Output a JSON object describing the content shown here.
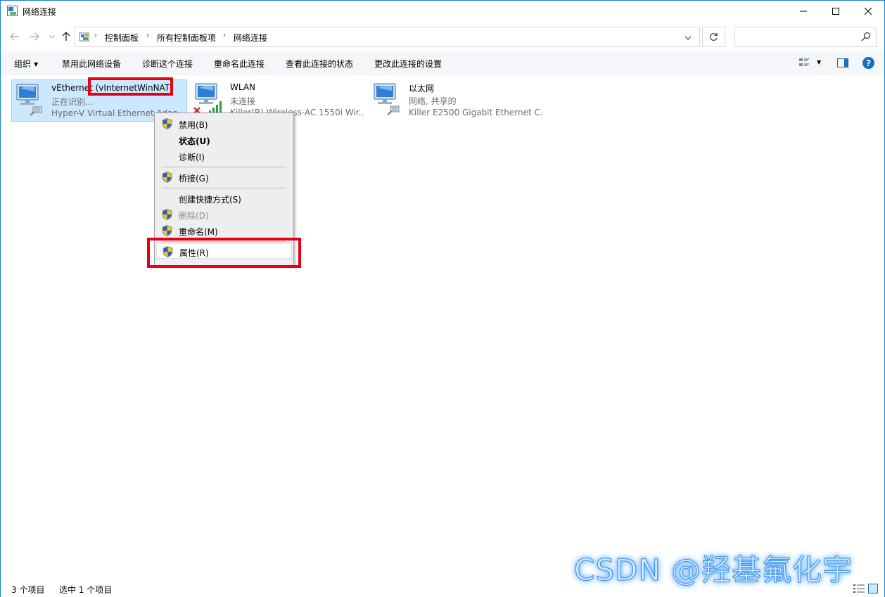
{
  "window": {
    "title": "网络连接",
    "controls": {
      "minimize": "—",
      "maximize": "☐",
      "close": "✕"
    }
  },
  "address": {
    "breadcrumbs": [
      "控制面板",
      "所有控制面板项",
      "网络连接"
    ],
    "search_placeholder": ""
  },
  "toolbar": {
    "organize": "组织",
    "commands": [
      "禁用此网络设备",
      "诊断这个连接",
      "重命名此连接",
      "查看此连接的状态",
      "更改此连接的设置"
    ]
  },
  "connections": [
    {
      "name": "vEthernet (vInternetWinNAT)",
      "name_prefix": "vEthernet ",
      "name_highlight": "(vInternetWinNAT)",
      "status": "正在识别...",
      "adapter": "Hyper-V Virtual Ethernet Adap...",
      "selected": true,
      "icon": "network-adapter-icon"
    },
    {
      "name": "WLAN",
      "status": "未连接",
      "adapter": "Killer(R) Wireless-AC 1550i Wir...",
      "selected": false,
      "icon": "wifi-adapter-disconnected-icon"
    },
    {
      "name": "以太网",
      "status": "网络, 共享的",
      "adapter": "Killer E2500 Gigabit Ethernet C...",
      "selected": false,
      "icon": "network-adapter-icon"
    }
  ],
  "context_menu": {
    "items": [
      {
        "label": "禁用(B)",
        "shield": true
      },
      {
        "label": "状态(U)",
        "shield": false,
        "bold": true
      },
      {
        "label": "诊断(I)",
        "shield": false
      },
      {
        "label": "桥接(G)",
        "shield": true
      },
      {
        "label": "创建快捷方式(S)",
        "shield": false
      },
      {
        "label": "删除(D)",
        "shield": true,
        "disabled": true
      },
      {
        "label": "重命名(M)",
        "shield": true
      },
      {
        "label": "属性(R)",
        "shield": true,
        "highlighted": true
      }
    ]
  },
  "status": {
    "item_count": "3 个项目",
    "selected_count": "选中 1 个项目"
  },
  "watermark": "CSDN @羟基氟化宇",
  "colors": {
    "accent": "#1883d7",
    "selection": "#cce8ff",
    "highlight_box": "#e60012"
  }
}
